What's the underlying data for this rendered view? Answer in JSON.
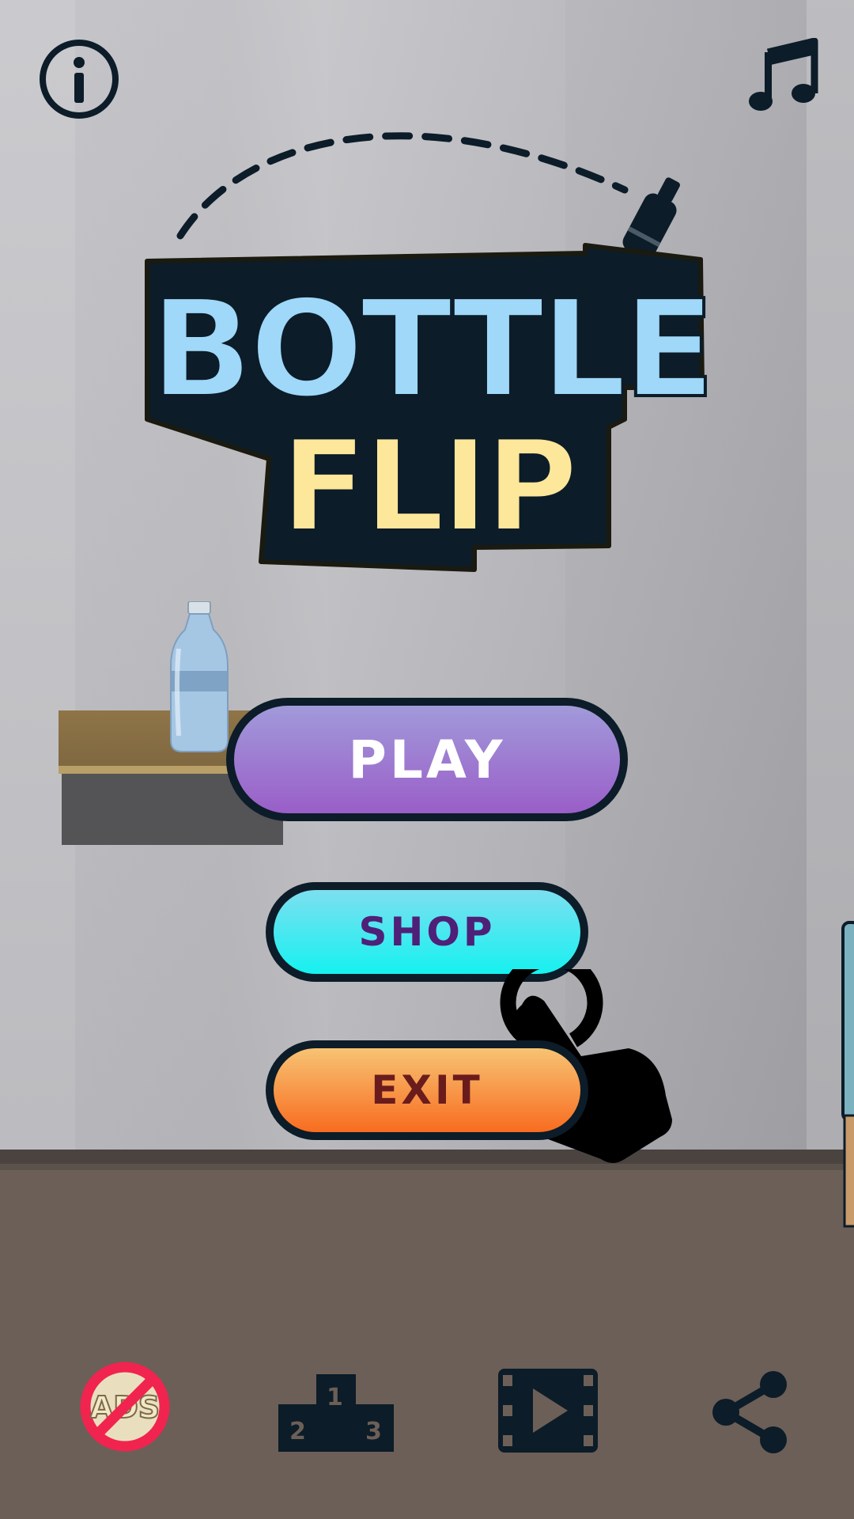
{
  "title": {
    "line1": "BOTTLE",
    "line2": "FLIP"
  },
  "menu": {
    "play_label": "PLAY",
    "shop_label": "SHOP",
    "exit_label": "EXIT"
  },
  "top_bar": {
    "info_icon": "info-icon",
    "music_icon": "music-note-icon"
  },
  "bottom_bar": {
    "no_ads_text": "ADS",
    "podium": {
      "first": "1",
      "second": "2",
      "third": "3"
    },
    "video_icon": "video-play-icon",
    "share_icon": "share-icon"
  },
  "colors": {
    "title_blue": "#9fd8f8",
    "title_yellow": "#fde79a",
    "outline": "#0c1c28",
    "play": "#9a6ac9",
    "shop": "#2de9f0",
    "exit": "#f78a3a",
    "no_ads_red": "#f0244f"
  }
}
